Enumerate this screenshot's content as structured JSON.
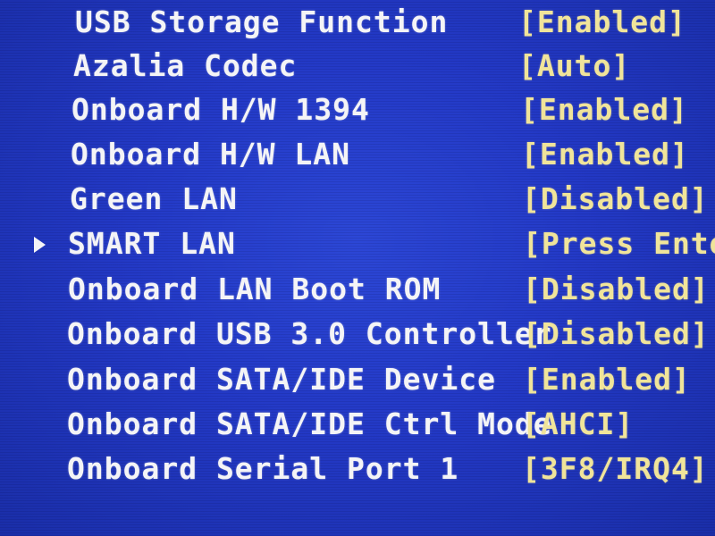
{
  "bios": {
    "items": [
      {
        "label": "USB Storage Function",
        "value": "[Enabled]"
      },
      {
        "label": "Azalia Codec",
        "value": "[Auto]"
      },
      {
        "label": "Onboard H/W 1394",
        "value": "[Enabled]"
      },
      {
        "label": "Onboard H/W LAN",
        "value": "[Enabled]"
      },
      {
        "label": "Green LAN",
        "value": "[Disabled]"
      },
      {
        "label": "SMART LAN",
        "value": "[Press Enter]",
        "submenu": true
      },
      {
        "label": "Onboard LAN Boot ROM",
        "value": "[Disabled]"
      },
      {
        "label": "Onboard USB 3.0 Controller",
        "value": "[Disabled]"
      },
      {
        "label": "Onboard SATA/IDE Device",
        "value": "[Enabled]"
      },
      {
        "label": "Onboard SATA/IDE Ctrl Mode",
        "value": "[AHCI]"
      },
      {
        "label": "Onboard Serial Port 1",
        "value": "[3F8/IRQ4]"
      }
    ]
  }
}
